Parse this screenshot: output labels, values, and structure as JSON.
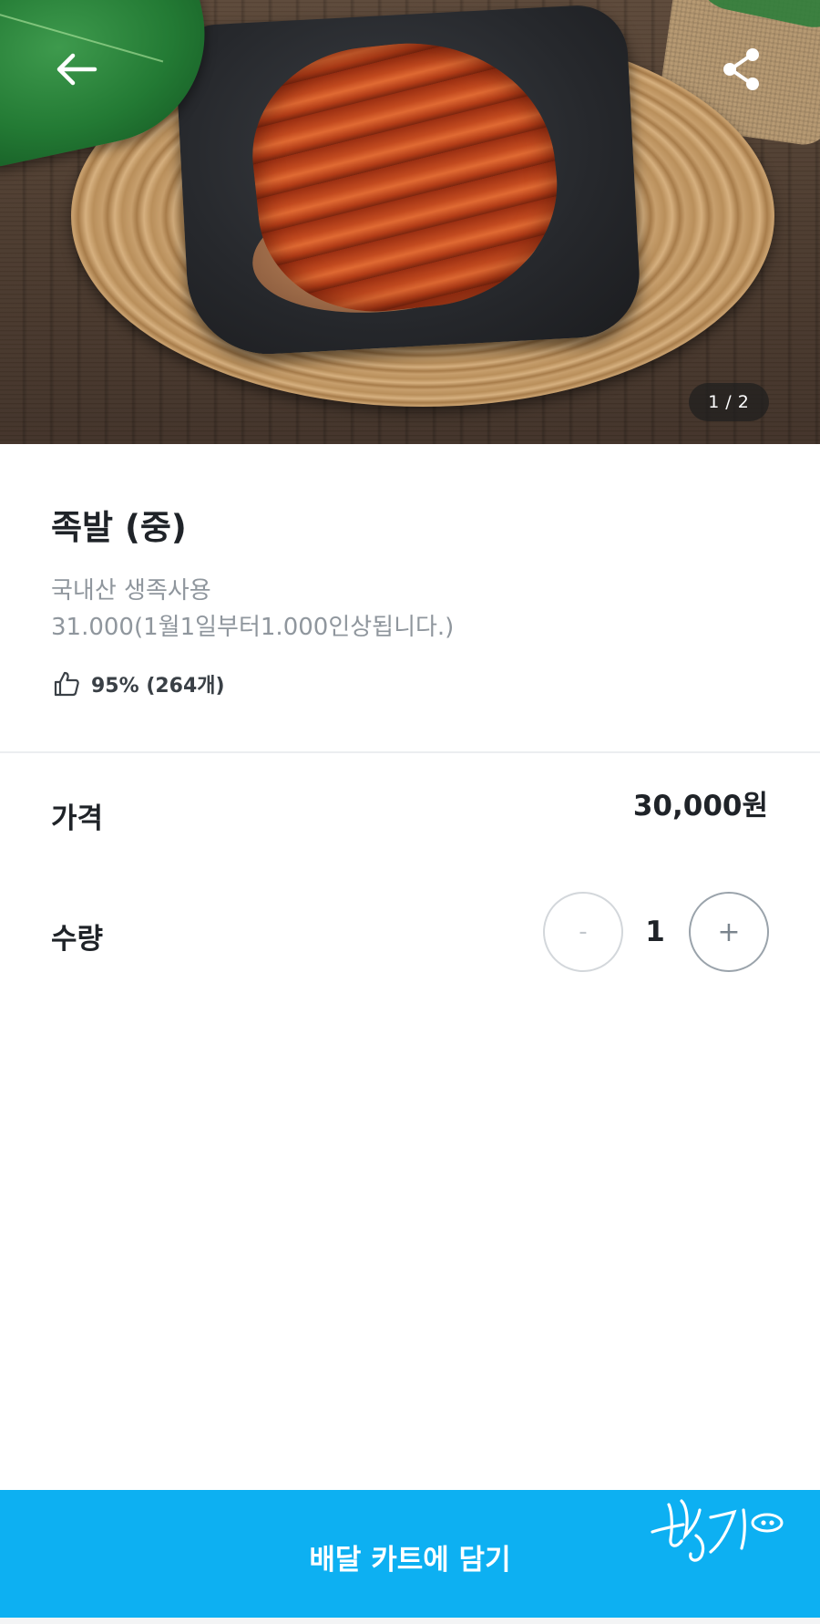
{
  "hero": {
    "page_current": "1",
    "page_separator": "/",
    "page_total": "2",
    "back_icon": "arrow-left-icon",
    "share_icon": "share-icon"
  },
  "product": {
    "title": "족발 (중)",
    "description_line1": "국내산 생족사용",
    "description_line2": "31.000(1월1일부터1.000인상됩니다.)",
    "rating_icon": "thumbs-up-icon",
    "rating_text": "95% (264개)"
  },
  "price": {
    "label": "가격",
    "value": "30,000원"
  },
  "quantity": {
    "label": "수량",
    "minus_label": "-",
    "value": "1",
    "plus_label": "+"
  },
  "cta": {
    "label": "배달 카트에 담기",
    "logo_text": "행지",
    "color": "#0db0f2"
  }
}
